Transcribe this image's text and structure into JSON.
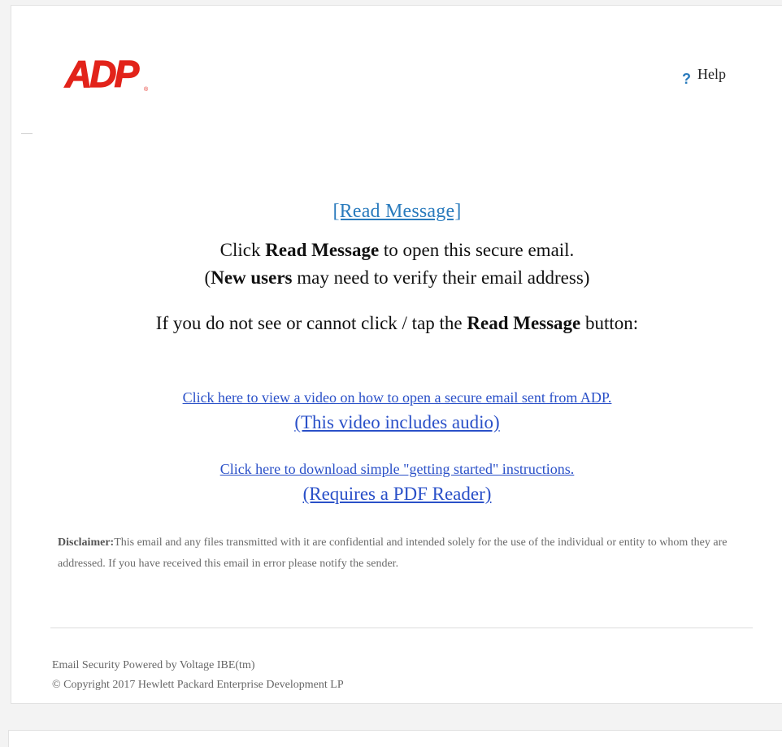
{
  "header": {
    "logo_text": "ADP",
    "help_label": "Help"
  },
  "main": {
    "read_message_link": "[Read Message]",
    "line1_prefix": "Click ",
    "line1_bold": "Read Message",
    "line1_suffix": " to open this secure email.",
    "line2_prefix": "(",
    "line2_bold": "New users",
    "line2_suffix": " may need to verify their email address)",
    "line3_prefix": "If you do not see or cannot click / tap the ",
    "line3_bold": "Read Message",
    "line3_suffix": " button:",
    "video_link": "Click here to view a video on how to open a secure email sent from ADP.",
    "video_sub": "(This video includes audio)",
    "pdf_link": "Click here to download simple \"getting started\" instructions.",
    "pdf_sub": "(Requires a PDF Reader)"
  },
  "disclaimer": {
    "label": "Disclaimer:",
    "text": "This email and any files transmitted with it are confidential and intended solely for the use of the individual or entity to whom they are addressed. If you have received this email in error please notify the sender."
  },
  "footer": {
    "line1": "Email Security Powered by Voltage IBE(tm)",
    "line2": "© Copyright 2017 Hewlett Packard Enterprise Development LP"
  },
  "colors": {
    "brand_red": "#e2231a",
    "link_blue": "#2a50c8",
    "read_link_blue": "#2a7bbd"
  }
}
